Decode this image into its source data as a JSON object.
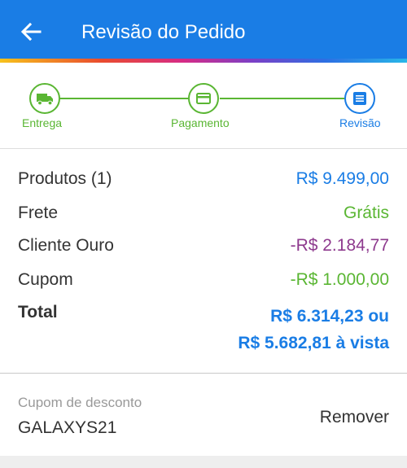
{
  "header": {
    "title": "Revisão do Pedido",
    "back_icon": "arrow-left-icon",
    "background_color": "#1a7de5"
  },
  "stepper": {
    "steps": [
      {
        "label": "Entrega",
        "icon": "truck-icon",
        "status": "completed"
      },
      {
        "label": "Pagamento",
        "icon": "credit-card-icon",
        "status": "completed"
      },
      {
        "label": "Revisão",
        "icon": "list-icon",
        "status": "current"
      }
    ],
    "completed_color": "#5ab633",
    "current_color": "#1a7de5"
  },
  "summary": {
    "products": {
      "label": "Produtos (1)",
      "value": "R$ 9.499,00",
      "color": "#1a7de5"
    },
    "shipping": {
      "label": "Frete",
      "value": "Grátis",
      "color": "#5ab633"
    },
    "gold_client": {
      "label": "Cliente Ouro",
      "value": "-R$ 2.184,77",
      "color": "#8e3a8e"
    },
    "coupon": {
      "label": "Cupom",
      "value": "-R$ 1.000,00",
      "color": "#5ab633"
    },
    "total": {
      "label": "Total",
      "value_installments": "R$ 6.314,23 ou",
      "value_cash": "R$ 5.682,81 à vista",
      "color": "#1a7de5"
    }
  },
  "coupon_section": {
    "label": "Cupom de desconto",
    "code": "GALAXYS21",
    "remove_label": "Remover"
  }
}
